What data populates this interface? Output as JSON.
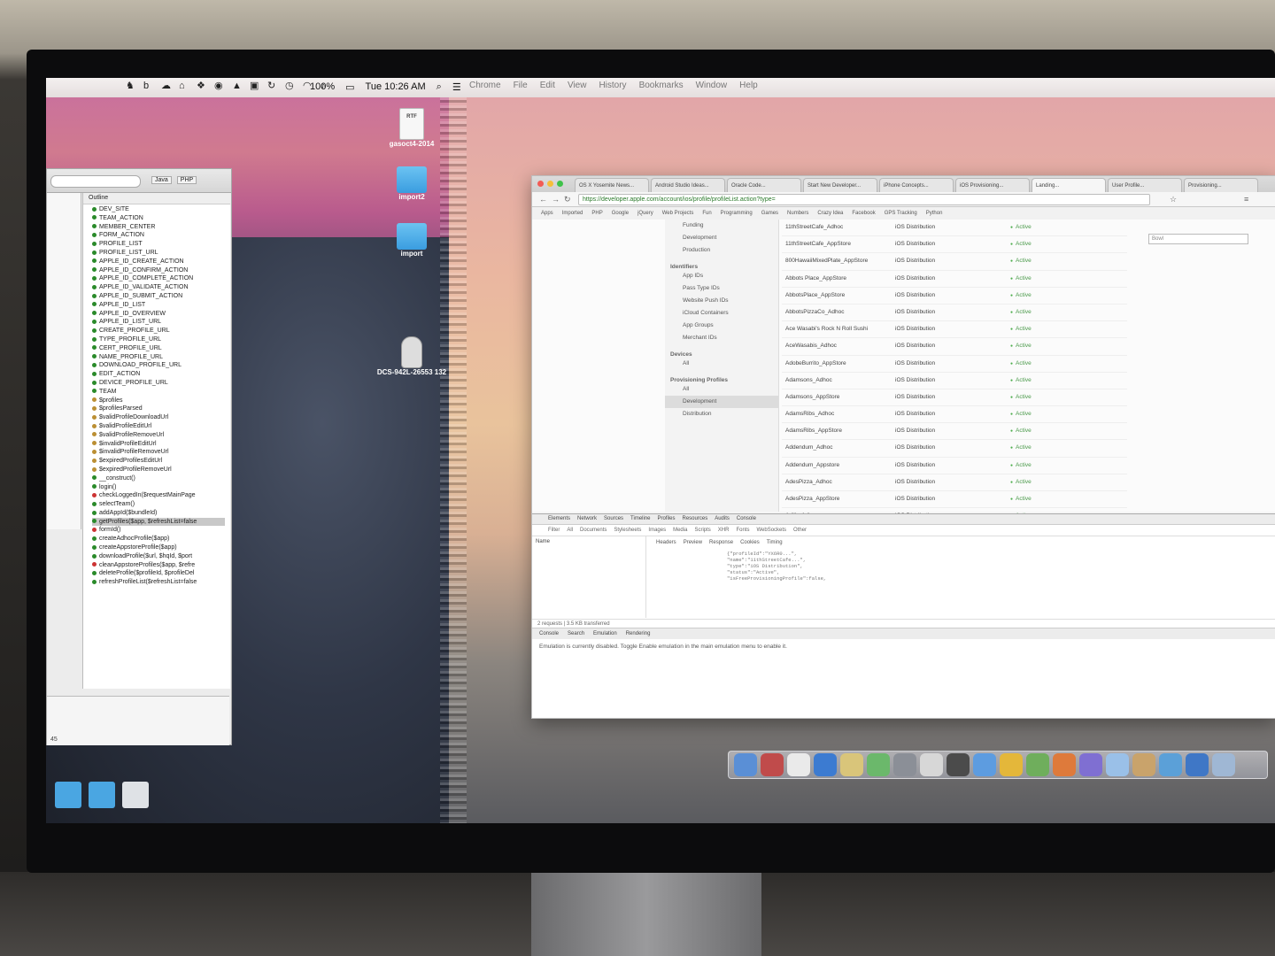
{
  "menubar": {
    "battery": "100%",
    "clock": "Tue 10:26 AM",
    "app_menus": [
      "Chrome",
      "File",
      "Edit",
      "View",
      "History",
      "Bookmarks",
      "Window",
      "Help"
    ]
  },
  "desktop_icons": [
    {
      "label": "gasoct4-2014",
      "kind": "RTF"
    },
    {
      "label": "import2"
    },
    {
      "label": "import"
    },
    {
      "label": "DCS-942L-26553 132"
    }
  ],
  "ide": {
    "perspectives": [
      "Java",
      "PHP"
    ],
    "outline_title": "Outline",
    "outline_items": [
      "DEV_SITE",
      "TEAM_ACTION",
      "MEMBER_CENTER",
      "FORM_ACTION",
      "PROFILE_LIST",
      "PROFILE_LIST_URL",
      "APPLE_ID_CREATE_ACTION",
      "APPLE_ID_CONFIRM_ACTION",
      "APPLE_ID_COMPLETE_ACTION",
      "APPLE_ID_VALIDATE_ACTION",
      "APPLE_ID_SUBMIT_ACTION",
      "APPLE_ID_LIST",
      "APPLE_ID_OVERVIEW",
      "APPLE_ID_LIST_URL",
      "CREATE_PROFILE_URL",
      "TYPE_PROFILE_URL",
      "CERT_PROFILE_URL",
      "NAME_PROFILE_URL",
      "DOWNLOAD_PROFILE_URL",
      "EDIT_ACTION",
      "DEVICE_PROFILE_URL",
      "TEAM",
      "$profiles",
      "$profilesParsed",
      "$validProfileDownloadUrl",
      "$validProfileEditUrl",
      "$validProfileRemoveUrl",
      "$invalidProfileEditUrl",
      "$invalidProfileRemoveUrl",
      "$expiredProfilesEditUrl",
      "$expiredProfileRemoveUrl",
      "__construct()",
      "login()",
      "checkLoggedIn($requestMainPage",
      "selectTeam()",
      "addAppId($bundleId)",
      "getProfiles($app, $refreshList=false",
      "formId()",
      "createAdhocProfile($app)",
      "createAppstoreProfile($app)",
      "downloadProfile($url, $hqId, $port",
      "cleanAppstoreProfiles($app, $refre",
      "deleteProfile($profileId, $profileDel",
      "refreshProfileList($refreshList=false"
    ],
    "selected_index": 36,
    "status_number": "45"
  },
  "chrome": {
    "tabs": [
      "OS X Yosemite News...",
      "Android Studio Ideas...",
      "Oracle Code...",
      "Start New Developer...",
      "iPhone Concepts...",
      "iOS Provisioning...",
      "Landing...",
      "User Profile...",
      "Provisioning..."
    ],
    "url": "https://developer.apple.com/account/ios/profile/profileList.action?type=",
    "bookmarks": [
      "Apps",
      "Imported",
      "PHP",
      "Google",
      "jQuery",
      "Web Projects",
      "Fun",
      "Programming",
      "Games",
      "Numbers",
      "Crazy Idea",
      "Facebook",
      "GPS Tracking",
      "Python"
    ],
    "find_value": "Bowl",
    "sidebar": [
      {
        "type": "item",
        "label": "Funding"
      },
      {
        "type": "item",
        "label": "Development"
      },
      {
        "type": "item",
        "label": "Production"
      },
      {
        "type": "section",
        "label": "Identifiers"
      },
      {
        "type": "item",
        "label": "App IDs"
      },
      {
        "type": "item",
        "label": "Pass Type IDs"
      },
      {
        "type": "item",
        "label": "Website Push IDs"
      },
      {
        "type": "item",
        "label": "iCloud Containers"
      },
      {
        "type": "item",
        "label": "App Groups"
      },
      {
        "type": "item",
        "label": "Merchant IDs"
      },
      {
        "type": "section",
        "label": "Devices"
      },
      {
        "type": "item",
        "label": "All"
      },
      {
        "type": "section",
        "label": "Provisioning Profiles"
      },
      {
        "type": "item",
        "label": "All"
      },
      {
        "type": "item",
        "label": "Development",
        "highlight": true
      },
      {
        "type": "item",
        "label": "Distribution"
      }
    ],
    "profiles": [
      {
        "name": "11thStreetCafe_Adhoc",
        "type": "iOS Distribution",
        "status": "Active"
      },
      {
        "name": "11thStreetCafe_AppStore",
        "type": "iOS Distribution",
        "status": "Active"
      },
      {
        "name": "800HawaiiMixedPlate_AppStore",
        "type": "iOS Distribution",
        "status": "Active"
      },
      {
        "name": "Abbots Place_AppStore",
        "type": "iOS Distribution",
        "status": "Active"
      },
      {
        "name": "AbbotsPlace_AppStore",
        "type": "iOS Distribution",
        "status": "Active"
      },
      {
        "name": "AbbotsPizzaCo_Adhoc",
        "type": "iOS Distribution",
        "status": "Active"
      },
      {
        "name": "Ace Wasabi's Rock N Roll Sushi",
        "type": "iOS Distribution",
        "status": "Active"
      },
      {
        "name": "AceWasabis_Adhoc",
        "type": "iOS Distribution",
        "status": "Active"
      },
      {
        "name": "AdobeBurrito_AppStore",
        "type": "iOS Distribution",
        "status": "Active"
      },
      {
        "name": "Adamsons_Adhoc",
        "type": "iOS Distribution",
        "status": "Active"
      },
      {
        "name": "Adamsons_AppStore",
        "type": "iOS Distribution",
        "status": "Active"
      },
      {
        "name": "AdamsRibs_Adhoc",
        "type": "iOS Distribution",
        "status": "Active"
      },
      {
        "name": "AdamsRibs_AppStore",
        "type": "iOS Distribution",
        "status": "Active"
      },
      {
        "name": "Addendum_Adhoc",
        "type": "iOS Distribution",
        "status": "Active"
      },
      {
        "name": "Addendum_Appstore",
        "type": "iOS Distribution",
        "status": "Active"
      },
      {
        "name": "AdesPizza_Adhoc",
        "type": "iOS Distribution",
        "status": "Active"
      },
      {
        "name": "AdesPizza_AppStore",
        "type": "iOS Distribution",
        "status": "Active"
      },
      {
        "name": "Adlib_Adhoc",
        "type": "iOS Distribution",
        "status": "Active"
      }
    ],
    "devtools": {
      "tabs": [
        "Elements",
        "Network",
        "Sources",
        "Timeline",
        "Profiles",
        "Resources",
        "Audits",
        "Console"
      ],
      "filters": [
        "Filter",
        "All",
        "Documents",
        "Stylesheets",
        "Images",
        "Media",
        "Scripts",
        "XHR",
        "Fonts",
        "WebSockets",
        "Other"
      ],
      "subtabs": [
        "Headers",
        "Preview",
        "Response",
        "Cookies",
        "Timing"
      ],
      "name_col": "Name",
      "response_lines": [
        "{\"profileId\":\"YX6R0...\",",
        "  \"name\":\"11thStreetCafe...\",",
        "  \"type\":\"iOS Distribution\",",
        "  \"status\":\"Active\",",
        "  \"isFreeProvisioningProfile\":false,"
      ],
      "status": "2 requests | 3.5 KB transferred",
      "drawer_tabs": [
        "Console",
        "Search",
        "Emulation",
        "Rendering"
      ],
      "message": "Emulation is currently disabled. Toggle Enable emulation in the main emulation menu to enable it."
    }
  }
}
